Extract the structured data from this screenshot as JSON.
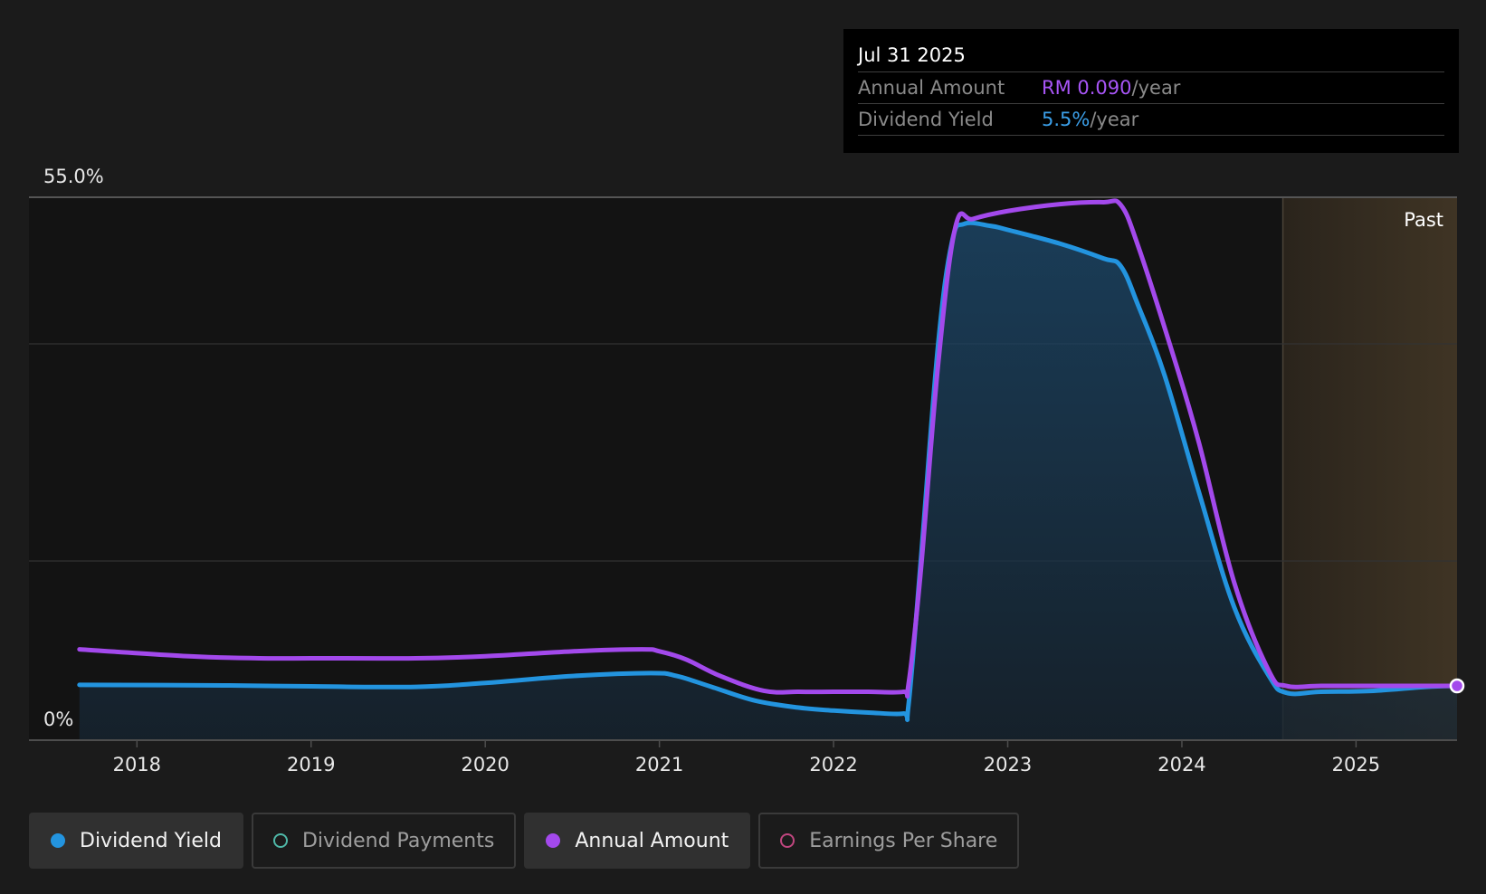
{
  "chart_data": {
    "type": "area",
    "y_top_label": "55.0%",
    "y_bottom_label": "0%",
    "ylim": [
      0,
      55
    ],
    "xlim": [
      2017.38,
      2025.58
    ],
    "x_ticks": [
      "2018",
      "2019",
      "2020",
      "2021",
      "2022",
      "2023",
      "2024",
      "2025"
    ],
    "x_tick_values": [
      2018,
      2019,
      2020,
      2021,
      2022,
      2023,
      2024,
      2025
    ],
    "past_label": "Past",
    "past_start": 2024.58,
    "grid": true,
    "series": [
      {
        "name": "Dividend Yield",
        "color": "#2394df",
        "fill": true,
        "x": [
          2017.67,
          2018.5,
          2019.0,
          2019.6,
          2020.0,
          2020.5,
          2020.95,
          2021.1,
          2021.3,
          2021.55,
          2021.8,
          2022.0,
          2022.2,
          2022.4,
          2022.43,
          2022.5,
          2022.6,
          2022.68,
          2022.75,
          2022.9,
          2023.0,
          2023.3,
          2023.55,
          2023.65,
          2023.75,
          2023.9,
          2024.1,
          2024.3,
          2024.5,
          2024.6,
          2024.8,
          2025.1,
          2025.4,
          2025.58
        ],
        "y": [
          5.6,
          5.55,
          5.45,
          5.4,
          5.8,
          6.5,
          6.8,
          6.5,
          5.4,
          4.0,
          3.3,
          3.0,
          2.8,
          2.7,
          3.5,
          18.0,
          40.0,
          50.5,
          52.3,
          52.1,
          51.7,
          50.3,
          48.8,
          48.0,
          44.0,
          37.0,
          25.0,
          13.5,
          6.5,
          4.8,
          4.9,
          5.0,
          5.4,
          5.5
        ]
      },
      {
        "name": "Annual Amount",
        "color": "#a349ec",
        "fill": false,
        "x": [
          2017.67,
          2018.3,
          2018.7,
          2019.0,
          2019.6,
          2020.0,
          2020.5,
          2020.9,
          2021.0,
          2021.15,
          2021.35,
          2021.6,
          2021.8,
          2022.0,
          2022.2,
          2022.4,
          2022.43,
          2022.5,
          2022.6,
          2022.7,
          2022.8,
          2023.0,
          2023.3,
          2023.55,
          2023.65,
          2023.75,
          2023.95,
          2024.1,
          2024.3,
          2024.5,
          2024.6,
          2024.8,
          2025.1,
          2025.4,
          2025.58
        ],
        "y": [
          9.2,
          8.5,
          8.3,
          8.3,
          8.3,
          8.5,
          9.0,
          9.2,
          9.0,
          8.2,
          6.5,
          5.0,
          4.9,
          4.9,
          4.9,
          4.9,
          5.6,
          17.0,
          38.0,
          52.0,
          52.8,
          53.6,
          54.3,
          54.5,
          54.2,
          50.0,
          39.0,
          30.0,
          16.0,
          7.0,
          5.5,
          5.5,
          5.5,
          5.5,
          5.5
        ]
      }
    ],
    "highlight_point": {
      "x": 2025.58,
      "y": 5.5
    }
  },
  "tooltip": {
    "date": "Jul 31 2025",
    "rows": [
      {
        "label": "Annual Amount",
        "value": "RM 0.090",
        "unit": "/year",
        "color": "#a855f7"
      },
      {
        "label": "Dividend Yield",
        "value": "5.5%",
        "unit": "/year",
        "color": "#3b9fe8"
      }
    ]
  },
  "legend": [
    {
      "label": "Dividend Yield",
      "color": "#2394df",
      "filled": true,
      "active": true
    },
    {
      "label": "Dividend Payments",
      "color": "#4fb8a8",
      "filled": false,
      "active": false
    },
    {
      "label": "Annual Amount",
      "color": "#a349ec",
      "filled": true,
      "active": true
    },
    {
      "label": "Earnings Per Share",
      "color": "#c0467f",
      "filled": false,
      "active": false
    }
  ]
}
